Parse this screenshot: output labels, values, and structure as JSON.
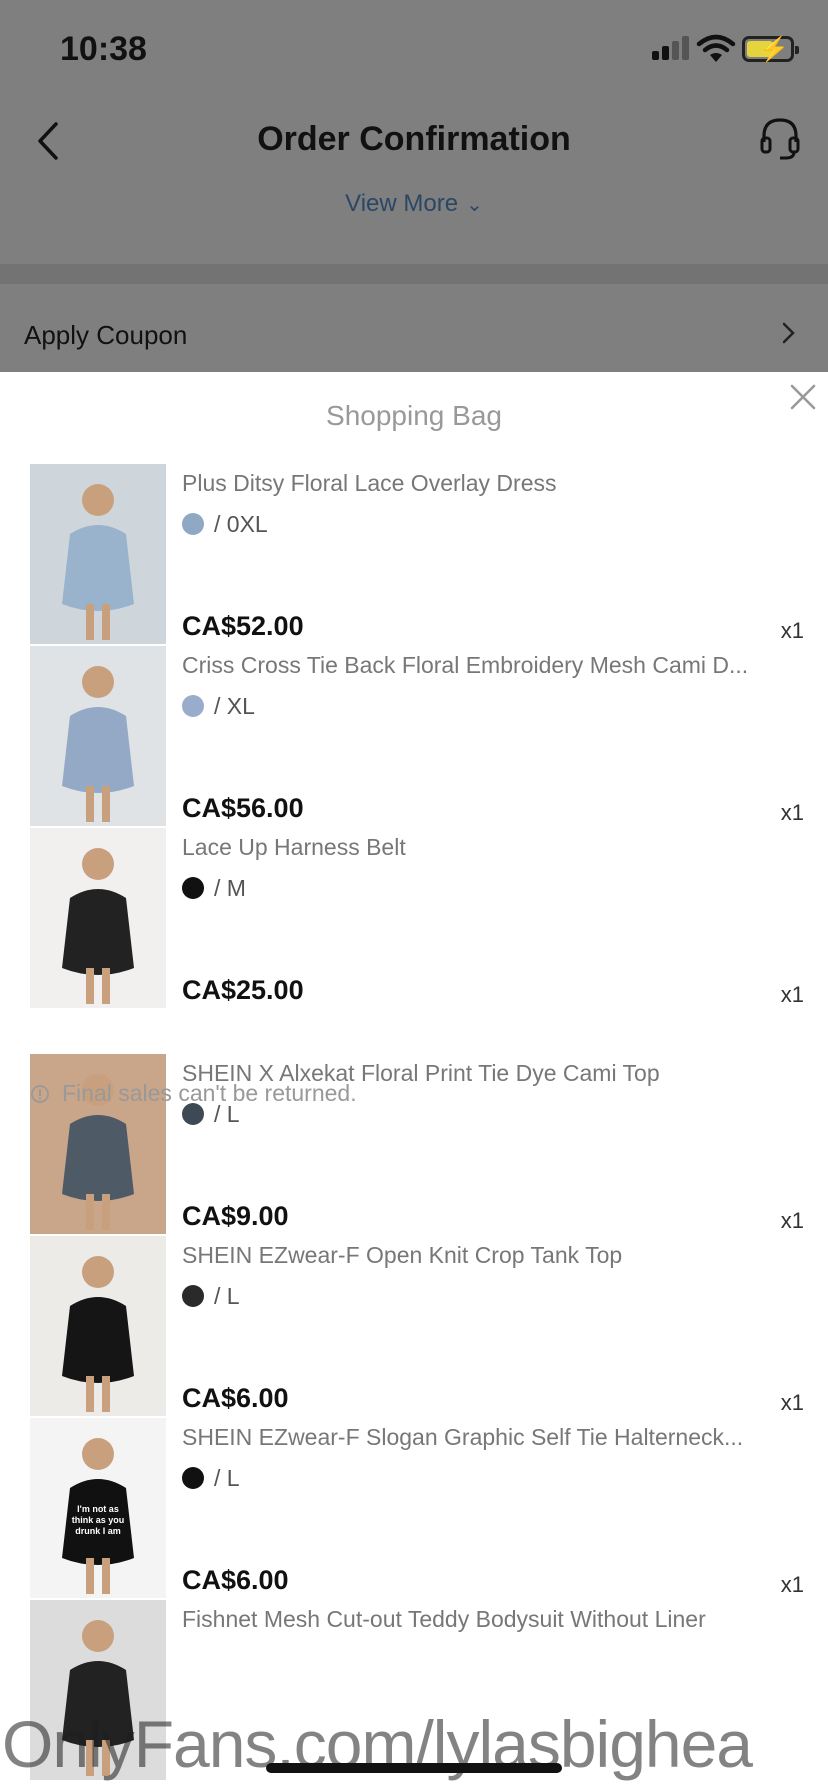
{
  "status": {
    "time": "10:38"
  },
  "header": {
    "title": "Order Confirmation",
    "view_more": "View More"
  },
  "coupon": {
    "label": "Apply Coupon"
  },
  "sheet": {
    "title": "Shopping Bag",
    "items": [
      {
        "name": "Plus Ditsy Floral Lace Overlay Dress",
        "size": "0XL",
        "price": "CA$52.00",
        "qty": "x1",
        "swatch": "#8fa8c4",
        "thumb_bg": "#cfd6db",
        "thumb_fg": "#9ab3cc"
      },
      {
        "name": "Criss Cross Tie Back Floral Embroidery Mesh Cami D...",
        "size": "XL",
        "price": "CA$56.00",
        "qty": "x1",
        "swatch": "#9aaccb",
        "thumb_bg": "#dfe3e6",
        "thumb_fg": "#93a9c6"
      },
      {
        "name": "Lace Up Harness Belt",
        "size": "M",
        "price": "CA$25.00",
        "qty": "x1",
        "swatch": "#111111",
        "thumb_bg": "#f2f0ee",
        "thumb_fg": "#222222"
      },
      {
        "name": "SHEIN X Alxekat Floral Print Tie Dye Cami Top",
        "size": "L",
        "price": "CA$9.00",
        "qty": "x1",
        "swatch": "#3d4a55",
        "thumb_bg": "#c9a58a",
        "thumb_fg": "#4e5a66"
      },
      {
        "name": "SHEIN EZwear-F Open Knit Crop Tank Top",
        "size": "L",
        "price": "CA$6.00",
        "qty": "x1",
        "swatch": "#2a2a2a",
        "thumb_bg": "#ecebe8",
        "thumb_fg": "#151515"
      },
      {
        "name": "SHEIN EZwear-F Slogan Graphic Self Tie Halterneck...",
        "size": "L",
        "price": "CA$6.00",
        "qty": "x1",
        "swatch": "#111111",
        "thumb_bg": "#f4f4f4",
        "thumb_fg": "#111111",
        "thumb_text": "I'm not as think as you drunk I am"
      },
      {
        "name": "Fishnet Mesh Cut-out Teddy Bodysuit Without Liner",
        "size": "",
        "price": "",
        "qty": "",
        "swatch": "#111111",
        "thumb_bg": "#dcdcdc",
        "thumb_fg": "#222222"
      }
    ],
    "notice": "Final sales can't be returned."
  },
  "watermark": "OnlyFans.com/lylasbighea",
  "colors": {
    "overlay": "#7f7f7f",
    "link": "#2b4766",
    "sheet": "#ffffff"
  }
}
